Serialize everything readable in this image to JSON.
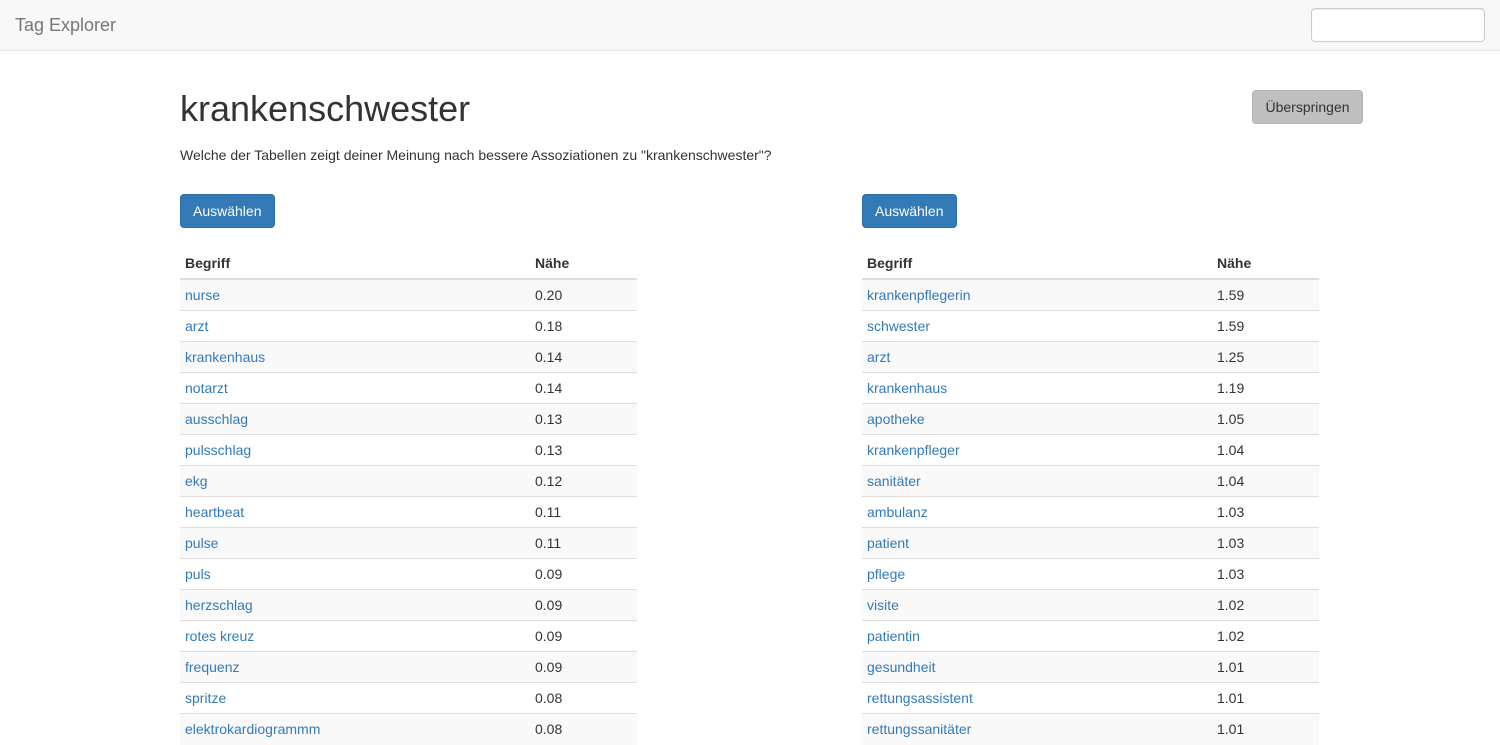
{
  "navbar": {
    "brand": "Tag Explorer",
    "search_value": "",
    "search_placeholder": ""
  },
  "main": {
    "title": "krankenschwester",
    "question": "Welche der Tabellen zeigt deiner Meinung nach bessere Assoziationen zu \"krankenschwester\"?",
    "skip_label": "Überspringen"
  },
  "left": {
    "select_label": "Auswählen",
    "headers": [
      "Begriff",
      "Nähe"
    ],
    "rows": [
      {
        "term": "nurse",
        "value": "0.20"
      },
      {
        "term": "arzt",
        "value": "0.18"
      },
      {
        "term": "krankenhaus",
        "value": "0.14"
      },
      {
        "term": "notarzt",
        "value": "0.14"
      },
      {
        "term": "ausschlag",
        "value": "0.13"
      },
      {
        "term": "pulsschlag",
        "value": "0.13"
      },
      {
        "term": "ekg",
        "value": "0.12"
      },
      {
        "term": "heartbeat",
        "value": "0.11"
      },
      {
        "term": "pulse",
        "value": "0.11"
      },
      {
        "term": "puls",
        "value": "0.09"
      },
      {
        "term": "herzschlag",
        "value": "0.09"
      },
      {
        "term": "rotes kreuz",
        "value": "0.09"
      },
      {
        "term": "frequenz",
        "value": "0.09"
      },
      {
        "term": "spritze",
        "value": "0.08"
      },
      {
        "term": "elektrokardiogrammm",
        "value": "0.08"
      }
    ]
  },
  "right": {
    "select_label": "Auswählen",
    "headers": [
      "Begriff",
      "Nähe"
    ],
    "rows": [
      {
        "term": "krankenpflegerin",
        "value": "1.59"
      },
      {
        "term": "schwester",
        "value": "1.59"
      },
      {
        "term": "arzt",
        "value": "1.25"
      },
      {
        "term": "krankenhaus",
        "value": "1.19"
      },
      {
        "term": "apotheke",
        "value": "1.05"
      },
      {
        "term": "krankenpfleger",
        "value": "1.04"
      },
      {
        "term": "sanitäter",
        "value": "1.04"
      },
      {
        "term": "ambulanz",
        "value": "1.03"
      },
      {
        "term": "patient",
        "value": "1.03"
      },
      {
        "term": "pflege",
        "value": "1.03"
      },
      {
        "term": "visite",
        "value": "1.02"
      },
      {
        "term": "patientin",
        "value": "1.02"
      },
      {
        "term": "gesundheit",
        "value": "1.01"
      },
      {
        "term": "rettungsassistent",
        "value": "1.01"
      },
      {
        "term": "rettungssanitäter",
        "value": "1.01"
      }
    ]
  },
  "colors": {
    "primary": "#337ab7",
    "link": "#337ab7",
    "navbar_bg": "#f8f8f8",
    "skip_button_bg": "#bfbfbf",
    "striped_row": "#f9f9f9"
  }
}
